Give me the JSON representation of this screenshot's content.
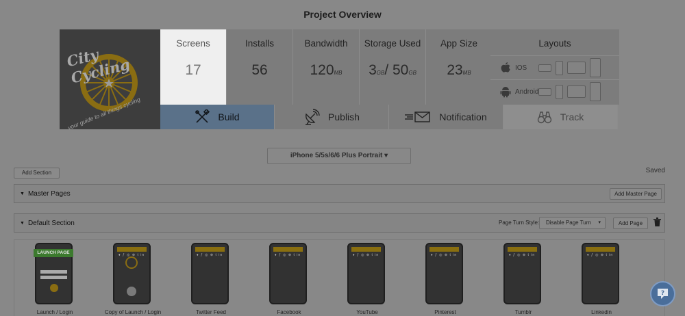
{
  "page": {
    "title": "Project Overview"
  },
  "logo": {
    "text": "City Cycling",
    "tagline": "your guide to all things cycling"
  },
  "stats": [
    {
      "label": "Screens",
      "value": "17",
      "unit": "",
      "active": true
    },
    {
      "label": "Installs",
      "value": "56",
      "unit": ""
    },
    {
      "label": "Bandwidth",
      "value": "120",
      "unit": "MB"
    },
    {
      "label": "Storage Used",
      "value": "3",
      "unit": "GB",
      "value2": "/ 50",
      "unit2": "GB"
    },
    {
      "label": "App Size",
      "value": "23",
      "unit": "MB"
    }
  ],
  "layouts": {
    "title": "Layouts",
    "ios": "IOS",
    "android": "Android"
  },
  "tabs": [
    {
      "label": "Build",
      "icon": "build-icon",
      "active": true
    },
    {
      "label": "Publish",
      "icon": "satellite-icon"
    },
    {
      "label": "Notification",
      "icon": "envelope-icon"
    },
    {
      "label": "Track",
      "icon": "binoculars-icon",
      "dim": true
    }
  ],
  "device_select": "iPhone 5/5s/6/6 Plus Portrait ▾",
  "buttons": {
    "add_section": "Add Section",
    "add_master_page": "Add Master Page",
    "add_page": "Add Page",
    "page_turn_label": "Page Turn Style:",
    "page_turn_value": "Disable Page Turn"
  },
  "status": {
    "saved": "Saved"
  },
  "sections": {
    "master": "Master Pages",
    "default": "Default Section"
  },
  "screens": [
    {
      "label": "Launch / Login",
      "badge": "LAUNCH PAGE"
    },
    {
      "label": "Copy of Launch / Login"
    },
    {
      "label": "Twitter Feed"
    },
    {
      "label": "Facebook"
    },
    {
      "label": "YouTube"
    },
    {
      "label": "Pinterest"
    },
    {
      "label": "Tumblr"
    },
    {
      "label": "Linkedin"
    }
  ],
  "colors": {
    "accent": "#5a7189",
    "gold": "#8a6f10",
    "overlay": "#888888"
  }
}
